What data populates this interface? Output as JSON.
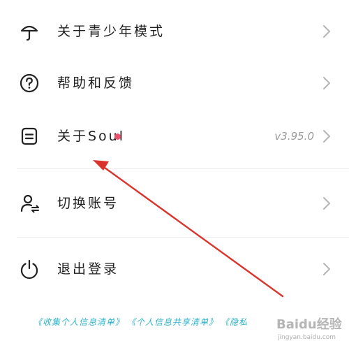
{
  "menu": {
    "items": [
      {
        "label": "关于青少年模式",
        "icon": "umbrella-icon"
      },
      {
        "label": "帮助和反馈",
        "icon": "help-circle-icon"
      },
      {
        "label": "关于Soul",
        "icon": "document-icon",
        "version": "v3.95.0",
        "has_badge": true
      },
      {
        "label": "切换账号",
        "icon": "switch-account-icon"
      },
      {
        "label": "退出登录",
        "icon": "power-icon"
      }
    ]
  },
  "footer": {
    "links": [
      "《收集个人信息清单》",
      "《个人信息共享清单》",
      "《隐私"
    ]
  },
  "watermark": {
    "text": "Baidu经验",
    "sub": "jingyan.baidu.com"
  },
  "colors": {
    "badge": "#e8506b",
    "annotation_arrow": "#d9342b",
    "footer_link": "#2fb3c9",
    "chevron": "#b5b5b5"
  }
}
